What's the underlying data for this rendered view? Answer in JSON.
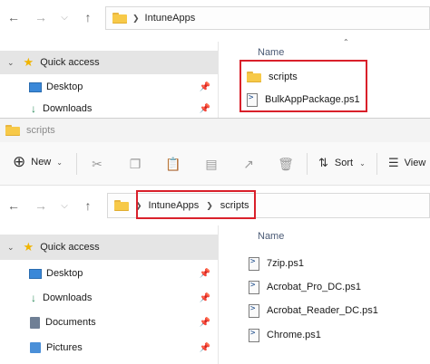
{
  "top_window": {
    "breadcrumb": [
      "IntuneApps"
    ],
    "sidebar": {
      "quick_access": "Quick access",
      "items": [
        {
          "label": "Desktop",
          "icon": "desktop-icon"
        },
        {
          "label": "Downloads",
          "icon": "download-icon"
        }
      ]
    },
    "column_name": "Name",
    "files": [
      {
        "label": "scripts",
        "icon": "folder-icon"
      },
      {
        "label": "BulkAppPackage.ps1",
        "icon": "ps1-file-icon"
      }
    ]
  },
  "scripts_window": {
    "title": "scripts",
    "toolbar": {
      "new_label": "New",
      "sort_label": "Sort",
      "view_label": "View"
    },
    "breadcrumb": [
      "IntuneApps",
      "scripts"
    ],
    "sidebar": {
      "quick_access": "Quick access",
      "items": [
        {
          "label": "Desktop",
          "icon": "desktop-icon"
        },
        {
          "label": "Downloads",
          "icon": "download-icon"
        },
        {
          "label": "Documents",
          "icon": "documents-icon"
        },
        {
          "label": "Pictures",
          "icon": "pictures-icon"
        }
      ]
    },
    "column_name": "Name",
    "files": [
      {
        "label": "7zip.ps1",
        "icon": "ps1-file-icon"
      },
      {
        "label": "Acrobat_Pro_DC.ps1",
        "icon": "ps1-file-icon"
      },
      {
        "label": "Acrobat_Reader_DC.ps1",
        "icon": "ps1-file-icon"
      },
      {
        "label": "Chrome.ps1",
        "icon": "ps1-file-icon"
      }
    ]
  },
  "colors": {
    "highlight_box": "#d9202a",
    "selection": "#e5e5e5",
    "folder": "#f7c948"
  }
}
